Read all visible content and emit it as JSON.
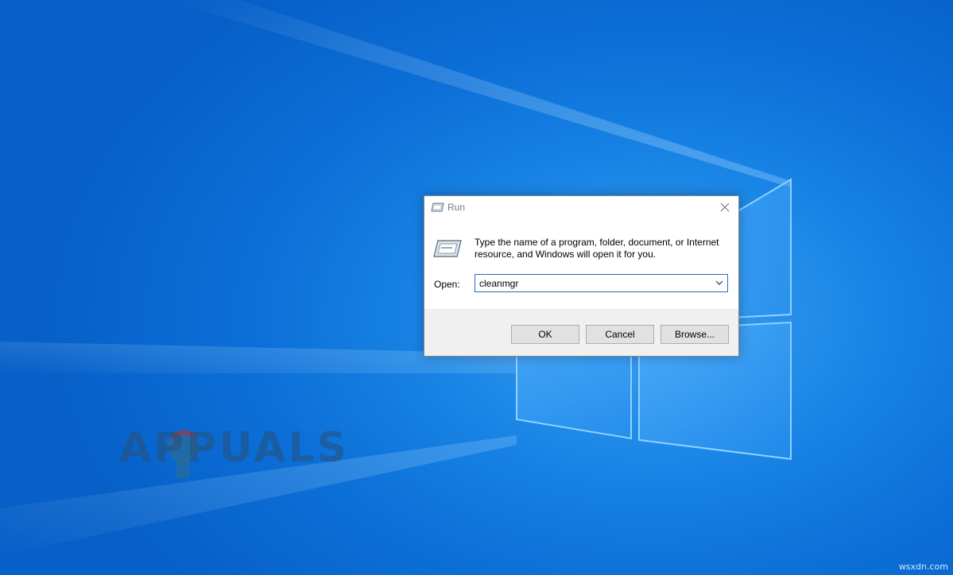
{
  "desktop": {
    "watermark_text": "APPUALS",
    "site_tag": "wsxdn.com"
  },
  "run_dialog": {
    "title": "Run",
    "description_line1": "Type the name of a program, folder, document, or Internet",
    "description_line2": "resource, and Windows will open it for you.",
    "open_label": "Open:",
    "open_value": "cleanmgr",
    "buttons": {
      "ok": "OK",
      "cancel": "Cancel",
      "browse": "Browse..."
    }
  },
  "icons": {
    "title_icon": "run-icon",
    "close_icon": "close-icon",
    "dropdown_icon": "chevron-down-icon",
    "program_icon": "run-program-icon"
  },
  "colors": {
    "desktop_blue": "#0c70d8",
    "input_border": "#2e6db5",
    "button_face": "#e1e1e1",
    "button_bar": "#f0f0f0"
  }
}
